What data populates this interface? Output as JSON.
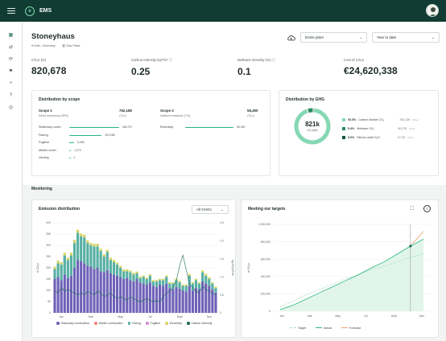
{
  "app": {
    "name": "EMS",
    "logo_letter": "e"
  },
  "nav": [
    {
      "name": "dashboard-icon",
      "glyph": "▦"
    },
    {
      "name": "flow-icon",
      "glyph": "⇄"
    },
    {
      "name": "cycle-icon",
      "glyph": "⟳"
    },
    {
      "name": "flag-icon",
      "glyph": "⚑"
    },
    {
      "name": "branch-icon",
      "glyph": "⑂"
    },
    {
      "name": "help-icon",
      "glyph": "?"
    },
    {
      "name": "globe-icon",
      "glyph": "◎"
    }
  ],
  "site": {
    "title": "Stoneyhaus",
    "location": "Köln, Germany",
    "type": "Gas Plant"
  },
  "filters": {
    "plant": "Entire plant",
    "period": "Year to date",
    "all_ghgs": "All GHGs"
  },
  "kpis": [
    {
      "label": "CO₂e (te)",
      "value": "820,678"
    },
    {
      "label": "Carbon intensity kg/Tm³",
      "value": "0.25"
    },
    {
      "label": "Methane intensity (%)",
      "value": "0.1"
    },
    {
      "label": "Cost of CO₂e",
      "value": "€24,620,338"
    }
  ],
  "scope": {
    "title": "Distribution by scope",
    "scope1": {
      "title": "Scope 1",
      "subtitle": "Direct emissions (98%)",
      "value": "762,188",
      "unit": "CO₂e"
    },
    "scope2": {
      "title": "Scope 2",
      "subtitle": "Indirect emissions (7%)",
      "value": "58,490",
      "unit": "CO₂e"
    },
    "scope1_rows": [
      {
        "label": "Stationary comb.",
        "value": "466,747",
        "frac": 1.0
      },
      {
        "label": "Flaring",
        "value": "303,288",
        "frac": 0.65
      },
      {
        "label": "Fugitive",
        "value": "8,496",
        "frac": 0.1
      },
      {
        "label": "Mobile comb.",
        "value": "1,270",
        "frac": 0.04
      },
      {
        "label": "Venting",
        "value": "0",
        "frac": 0.0
      }
    ],
    "scope2_rows": [
      {
        "label": "Electricity",
        "value": "58,490",
        "frac": 1.0
      }
    ]
  },
  "ghg": {
    "title": "Distribution by GHG",
    "center_value": "821k",
    "center_label": "CO₂e(te)",
    "items": [
      {
        "pct": "93.3%",
        "label": "Carbon dioxide CO₂",
        "value": "764,126",
        "unit": "CO₂e",
        "color": "#86d8b4"
      },
      {
        "pct": "5.4%",
        "label": "Methane CH₄",
        "value": "50,376",
        "unit": "CO₂e",
        "color": "#2a8a62"
      },
      {
        "pct": "0.6%",
        "label": "Nitrous oxide N₂O",
        "value": "5,176",
        "unit": "CO₂e",
        "color": "#155540"
      }
    ],
    "shares": [
      93.3,
      5.4,
      0.6
    ]
  },
  "monitoring": {
    "title": "Monitoring"
  },
  "emission_chart": {
    "title": "Emission distribution",
    "ylabel_left": "te CO₂e",
    "ylabel_right": "kg CO₂e/Tm³",
    "y_ticks": [
      "400",
      "350",
      "300",
      "250",
      "200",
      "150",
      "100",
      "50",
      "0"
    ],
    "y2_ticks": [
      "2.5",
      "2.0",
      "1.5",
      "1.0",
      "0.5",
      "0"
    ],
    "x_ticks": [
      "Jan",
      "Mar",
      "May",
      "Jul",
      "Sept",
      "Nov"
    ],
    "legend": [
      {
        "label": "Stationary combustion",
        "color": "#6f62b8"
      },
      {
        "label": "Mobile combustion",
        "color": "#f08a7a"
      },
      {
        "label": "Flaring",
        "color": "#58b0a4"
      },
      {
        "label": "Fugitive",
        "color": "#cf8fd6"
      },
      {
        "label": "Electricity",
        "color": "#d7d463"
      },
      {
        "label": "Carbon intensity",
        "color": "#1d6b57"
      }
    ]
  },
  "chart_data": [
    {
      "type": "bar",
      "title": "Emission distribution",
      "ylabel": "te CO₂e",
      "ylim": [
        0,
        400
      ],
      "y2label": "kg CO₂e/Tm³",
      "y2lim": [
        0,
        2.5
      ],
      "series": [
        {
          "name": "Stationary combustion",
          "values": [
            150,
            160,
            145,
            170,
            155,
            165,
            200,
            235,
            230,
            220,
            210,
            205,
            195,
            200,
            185,
            180,
            190,
            175,
            170,
            165,
            160,
            150,
            155,
            145,
            140,
            150,
            135,
            130,
            125,
            135,
            120,
            115,
            125,
            120,
            130,
            110,
            105,
            115,
            108,
            100,
            95,
            120,
            100,
            110,
            105,
            140,
            130,
            120,
            105,
            90
          ]
        },
        {
          "name": "Flaring",
          "values": [
            45,
            60,
            70,
            85,
            80,
            90,
            110,
            120,
            110,
            115,
            100,
            95,
            100,
            95,
            90,
            70,
            80,
            60,
            55,
            50,
            40,
            35,
            30,
            35,
            30,
            25,
            20,
            30,
            25,
            30,
            20,
            25,
            20,
            25,
            30,
            20,
            25,
            30,
            28,
            20,
            25,
            45,
            30,
            35,
            25,
            40,
            35,
            30,
            25,
            20
          ]
        },
        {
          "name": "Electricity",
          "values": [
            10,
            12,
            10,
            12,
            10,
            12,
            14,
            14,
            12,
            12,
            12,
            10,
            12,
            12,
            10,
            10,
            10,
            10,
            10,
            8,
            8,
            8,
            8,
            8,
            8,
            8,
            6,
            6,
            6,
            6,
            6,
            6,
            6,
            6,
            6,
            6,
            6,
            6,
            6,
            6,
            6,
            8,
            6,
            6,
            6,
            8,
            8,
            8,
            6,
            6
          ]
        }
      ],
      "line_series": {
        "name": "Carbon intensity",
        "axis": "right",
        "values": [
          0.6,
          0.55,
          0.7,
          0.6,
          0.65,
          0.6,
          0.55,
          0.5,
          0.55,
          0.5,
          0.6,
          0.55,
          0.5,
          0.6,
          0.55,
          0.45,
          0.5,
          0.55,
          0.45,
          0.4,
          0.45,
          0.4,
          0.35,
          0.45,
          0.4,
          0.35,
          0.3,
          0.35,
          0.4,
          0.35,
          0.3,
          0.35,
          0.3,
          0.45,
          0.55,
          0.6,
          0.7,
          0.9,
          1.3,
          1.6,
          1.2,
          0.8,
          0.7,
          0.6,
          0.55,
          0.75,
          0.65,
          0.6,
          0.55,
          0.5
        ]
      },
      "x_ticks": [
        "Jan",
        "Mar",
        "May",
        "Jul",
        "Sept",
        "Nov"
      ],
      "legend": "bottom"
    },
    {
      "type": "line",
      "title": "Meeting our targets",
      "ylabel": "te CO₂e",
      "ylim": [
        0,
        1000000
      ],
      "y_ticks": [
        "1,000,000",
        "800,000",
        "600,000",
        "400,000",
        "200,000",
        "0"
      ],
      "x_ticks": [
        "Jan",
        "Mar",
        "May",
        "Jul",
        "Sept",
        "Nov"
      ],
      "x": [
        0,
        1,
        2,
        3,
        4,
        5,
        6,
        7,
        8,
        9,
        10,
        11
      ],
      "series": [
        {
          "name": "Target",
          "values": [
            50000,
            120000,
            190000,
            250000,
            310000,
            370000,
            420000,
            480000,
            520000,
            570000,
            620000,
            660000
          ]
        },
        {
          "name": "Actual",
          "values": [
            20000,
            70000,
            140000,
            210000,
            280000,
            350000,
            420000,
            500000,
            570000,
            660000,
            750000,
            830000
          ]
        },
        {
          "name": "Forecast",
          "values": [
            null,
            null,
            null,
            null,
            null,
            null,
            null,
            null,
            null,
            null,
            750000,
            920000
          ]
        }
      ],
      "legend": "bottom"
    }
  ],
  "targets_chart": {
    "title": "Meeting our targets",
    "legend": [
      {
        "label": "Target",
        "color": "#a5ddc3"
      },
      {
        "label": "Actual",
        "color": "#2bb57c"
      },
      {
        "label": "Forecast",
        "color": "#f2a071"
      }
    ]
  }
}
